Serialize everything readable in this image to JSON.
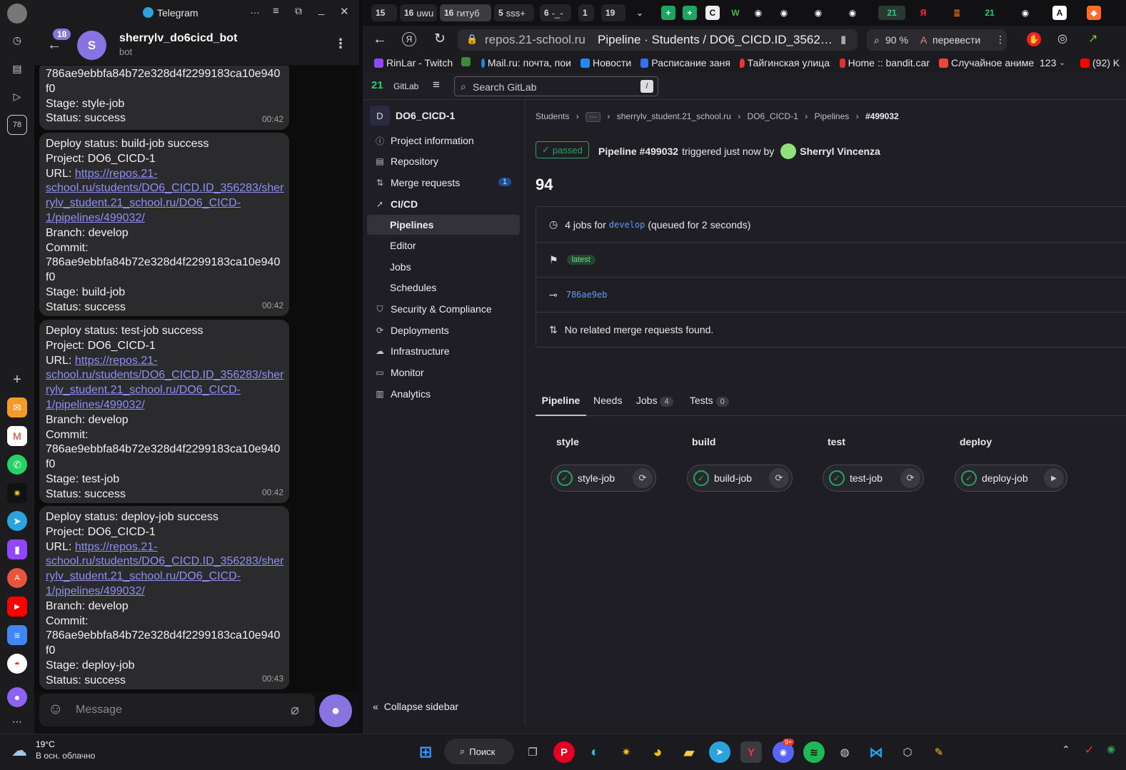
{
  "rail": {
    "badge_78": "78"
  },
  "telegram": {
    "window_title": "Telegram",
    "unread_badge": "18",
    "chat_avatar_letter": "S",
    "chat_name": "sherrylv_do6cicd_bot",
    "chat_subtitle": "bot",
    "messages": [
      {
        "lines": [
          "786ae9ebbfa84b72e328d4f2299183ca10e940",
          "f0",
          "Stage: style-job",
          "Status: success"
        ],
        "time": "00:42"
      },
      {
        "head": "Deploy status: build-job success",
        "project": "Project: DO6_CICD-1",
        "url_label": "URL: ",
        "url": [
          "https://repos.21-",
          "school.ru/students/DO6_CICD.ID_356283/sher",
          "rylv_student.21_school.ru/DO6_CICD-",
          "1/pipelines/499032/"
        ],
        "branch": "Branch: develop",
        "commit_label": "Commit:",
        "commit": [
          "786ae9ebbfa84b72e328d4f2299183ca10e940",
          "f0"
        ],
        "stage": "Stage: build-job",
        "status": "Status: success",
        "time": "00:42"
      },
      {
        "head": "Deploy status: test-job success",
        "project": "Project: DO6_CICD-1",
        "url_label": "URL: ",
        "url": [
          "https://repos.21-",
          "school.ru/students/DO6_CICD.ID_356283/sher",
          "rylv_student.21_school.ru/DO6_CICD-",
          "1/pipelines/499032/"
        ],
        "branch": "Branch: develop",
        "commit_label": "Commit:",
        "commit": [
          "786ae9ebbfa84b72e328d4f2299183ca10e940",
          "f0"
        ],
        "stage": "Stage: test-job",
        "status": "Status: success",
        "time": "00:42"
      },
      {
        "head": "Deploy status: deploy-job success",
        "project": "Project: DO6_CICD-1",
        "url_label": "URL: ",
        "url": [
          "https://repos.21-",
          "school.ru/students/DO6_CICD.ID_356283/sher",
          "rylv_student.21_school.ru/DO6_CICD-",
          "1/pipelines/499032/"
        ],
        "branch": "Branch: develop",
        "commit_label": "Commit:",
        "commit": [
          "786ae9ebbfa84b72e328d4f2299183ca10e940",
          "f0"
        ],
        "stage": "Stage: deploy-job",
        "status": "Status: success",
        "time": "00:43"
      }
    ],
    "input_placeholder": "Message"
  },
  "browser": {
    "tabs": [
      {
        "num": "15",
        "label": ""
      },
      {
        "num": "16",
        "label": "uwu"
      },
      {
        "num": "16",
        "label": "гитуб"
      },
      {
        "num": "5",
        "label": "sss+"
      },
      {
        "num": "6",
        "label": "-_-"
      },
      {
        "num": "1",
        "label": ""
      },
      {
        "num": "19",
        "label": ""
      }
    ],
    "address_host": "repos.21-school.ru",
    "page_title": "Pipeline · Students / DO6_CICD.ID_3562…",
    "zoom": "90 %",
    "translate": "перевести",
    "bookmarks": [
      "RinLar - Twitch",
      "Mail.ru: почта, пои",
      "Новости",
      "Расписание заня",
      "Тайгинская улица",
      "Home :: bandit.car",
      "Случайное аниме",
      "123",
      "(92) K"
    ]
  },
  "gitlab": {
    "brand": "GitLab",
    "search_placeholder": "Search GitLab",
    "search_shortcut": "/",
    "project_letter": "D",
    "project_name": "DO6_CICD-1",
    "nav": {
      "project_information": "Project information",
      "repository": "Repository",
      "merge_requests": "Merge requests",
      "merge_requests_count": "1",
      "cicd": "CI/CD",
      "pipelines": "Pipelines",
      "editor": "Editor",
      "jobs": "Jobs",
      "schedules": "Schedules",
      "security": "Security & Compliance",
      "deployments": "Deployments",
      "infrastructure": "Infrastructure",
      "monitor": "Monitor",
      "analytics": "Analytics",
      "collapse": "Collapse sidebar"
    },
    "breadcrumb": [
      "Students",
      "sherrylv_student.21_school.ru",
      "DO6_CICD-1",
      "Pipelines",
      "#499032"
    ],
    "status_badge": "passed",
    "pipeline_id": "Pipeline #499032",
    "triggered_text": "triggered just now by",
    "user_name": "Sherryl Vincenza",
    "pipeline_title": "94",
    "jobs_prefix": "4 jobs for",
    "branch": "develop",
    "queued_text": "(queued for 2 seconds)",
    "latest_badge": "latest",
    "commit_sha": "786ae9eb",
    "no_mr_text": "No related merge requests found.",
    "tabs": [
      {
        "label": "Pipeline",
        "count": ""
      },
      {
        "label": "Needs",
        "count": ""
      },
      {
        "label": "Jobs",
        "count": "4"
      },
      {
        "label": "Tests",
        "count": "0"
      }
    ],
    "stages": [
      {
        "name": "style",
        "job": "style-job",
        "action": "retry"
      },
      {
        "name": "build",
        "job": "build-job",
        "action": "retry"
      },
      {
        "name": "test",
        "job": "test-job",
        "action": "retry"
      },
      {
        "name": "deploy",
        "job": "deploy-job",
        "action": "play"
      }
    ],
    "colors": {
      "success": "#2da160",
      "link": "#5c9dff",
      "accent": "#8774e1"
    }
  },
  "taskbar": {
    "temperature": "19°C",
    "weather": "В осн. облачно",
    "search_label": "Поиск",
    "discord_badge": "9+"
  }
}
